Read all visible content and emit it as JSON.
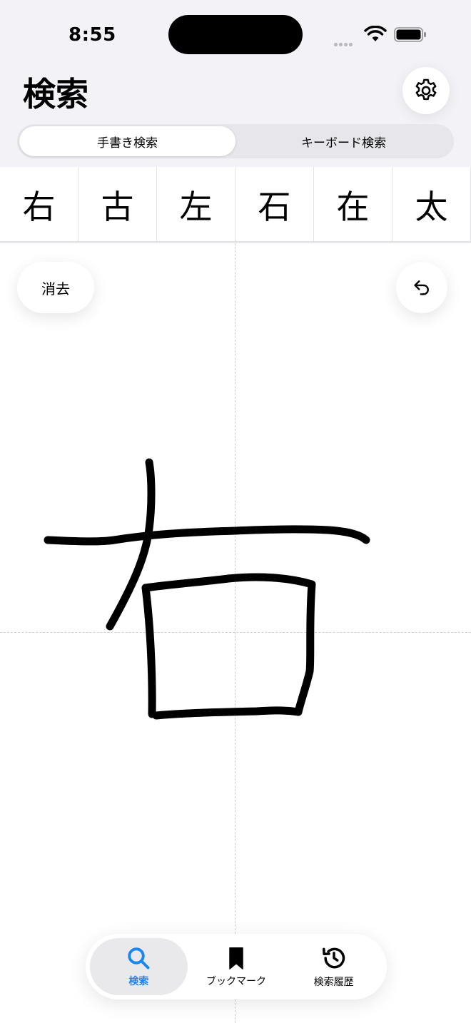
{
  "status_bar": {
    "time": "8:55"
  },
  "header": {
    "title": "検索"
  },
  "segments": [
    {
      "label": "手書き検索",
      "active": true
    },
    {
      "label": "キーボード検索",
      "active": false
    }
  ],
  "candidates": [
    "右",
    "古",
    "左",
    "石",
    "在",
    "太"
  ],
  "canvas": {
    "clear_label": "消去"
  },
  "tabbar": {
    "items": [
      {
        "label": "検索",
        "icon": "search-icon",
        "active": true
      },
      {
        "label": "ブックマーク",
        "icon": "bookmark-icon",
        "active": false
      },
      {
        "label": "検索履歴",
        "icon": "history-icon",
        "active": false
      }
    ]
  },
  "colors": {
    "accent": "#1a86f0",
    "background": "#f2f2f7",
    "ink": "#000000"
  }
}
